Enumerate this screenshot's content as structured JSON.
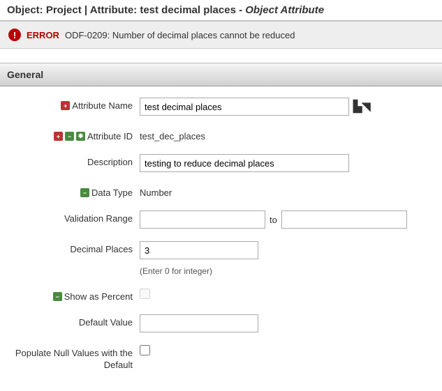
{
  "title": {
    "prefix": "Object: ",
    "object": "Project",
    "sep": " | ",
    "attr_prefix": "Attribute: ",
    "attr_name": "test decimal places",
    "dash": " - ",
    "suffix": "Object Attribute"
  },
  "error": {
    "label": "ERROR",
    "text": "ODF-0209: Number of decimal places cannot be reduced"
  },
  "section": {
    "general": "General"
  },
  "labels": {
    "attr_name": "Attribute Name",
    "attr_id": "Attribute ID",
    "description": "Description",
    "data_type": "Data Type",
    "validation_range": "Validation Range",
    "to": "to",
    "decimal_places": "Decimal Places",
    "decimal_hint": "(Enter 0 for integer)",
    "show_as_percent": "Show as Percent",
    "default_value": "Default Value",
    "populate_null": "Populate Null Values with the Default"
  },
  "values": {
    "attr_name": "test decimal places",
    "attr_id": "test_dec_places",
    "description": "testing to reduce decimal places",
    "data_type": "Number",
    "range_from": "",
    "range_to": "",
    "decimal_places": "3",
    "default_value": ""
  },
  "badges": {
    "required": "+",
    "lock": "−",
    "star": "✱"
  }
}
